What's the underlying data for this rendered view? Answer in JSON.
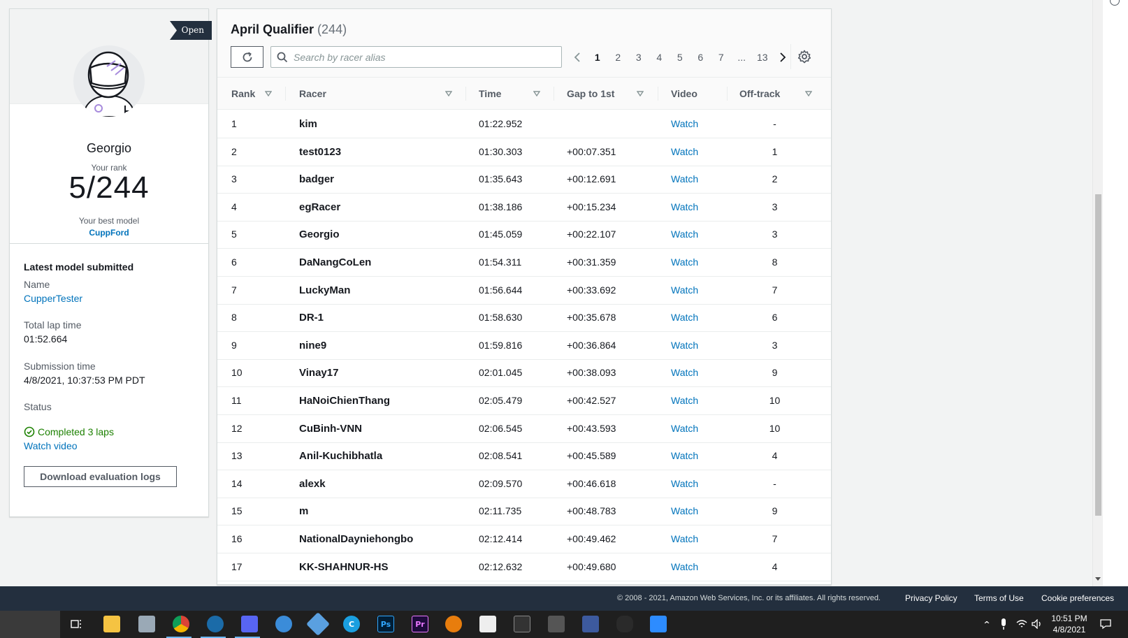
{
  "profile": {
    "badge": "Open",
    "name": "Georgio",
    "rank_label": "Your rank",
    "rank_value": "5/244",
    "best_model_label": "Your best model",
    "best_model": "CuppFord"
  },
  "latest_model": {
    "title": "Latest model submitted",
    "name_label": "Name",
    "name_value": "CupperTester",
    "lap_label": "Total lap time",
    "lap_value": "01:52.664",
    "submission_label": "Submission time",
    "submission_value": "4/8/2021, 10:37:53 PM PDT",
    "status_label": "Status",
    "status_value": "Completed 3 laps",
    "watch_video": "Watch video",
    "download_button": "Download evaluation logs"
  },
  "leaderboard": {
    "title": "April Qualifier",
    "count": "(244)",
    "search_placeholder": "Search by racer alias",
    "pages": [
      "1",
      "2",
      "3",
      "4",
      "5",
      "6",
      "7",
      "...",
      "13"
    ],
    "current_page": "1",
    "columns": {
      "rank": "Rank",
      "racer": "Racer",
      "time": "Time",
      "gap": "Gap to 1st",
      "video": "Video",
      "offtrack": "Off-track"
    },
    "rows": [
      {
        "rank": "1",
        "racer": "kim",
        "time": "01:22.952",
        "gap": "",
        "video": "Watch",
        "offtrack": "-"
      },
      {
        "rank": "2",
        "racer": "test0123",
        "time": "01:30.303",
        "gap": "+00:07.351",
        "video": "Watch",
        "offtrack": "1"
      },
      {
        "rank": "3",
        "racer": "badger",
        "time": "01:35.643",
        "gap": "+00:12.691",
        "video": "Watch",
        "offtrack": "2"
      },
      {
        "rank": "4",
        "racer": "egRacer",
        "time": "01:38.186",
        "gap": "+00:15.234",
        "video": "Watch",
        "offtrack": "3"
      },
      {
        "rank": "5",
        "racer": "Georgio",
        "time": "01:45.059",
        "gap": "+00:22.107",
        "video": "Watch",
        "offtrack": "3"
      },
      {
        "rank": "6",
        "racer": "DaNangCoLen",
        "time": "01:54.311",
        "gap": "+00:31.359",
        "video": "Watch",
        "offtrack": "8"
      },
      {
        "rank": "7",
        "racer": "LuckyMan",
        "time": "01:56.644",
        "gap": "+00:33.692",
        "video": "Watch",
        "offtrack": "7"
      },
      {
        "rank": "8",
        "racer": "DR-1",
        "time": "01:58.630",
        "gap": "+00:35.678",
        "video": "Watch",
        "offtrack": "6"
      },
      {
        "rank": "9",
        "racer": "nine9",
        "time": "01:59.816",
        "gap": "+00:36.864",
        "video": "Watch",
        "offtrack": "3"
      },
      {
        "rank": "10",
        "racer": "Vinay17",
        "time": "02:01.045",
        "gap": "+00:38.093",
        "video": "Watch",
        "offtrack": "9"
      },
      {
        "rank": "11",
        "racer": "HaNoiChienThang",
        "time": "02:05.479",
        "gap": "+00:42.527",
        "video": "Watch",
        "offtrack": "10"
      },
      {
        "rank": "12",
        "racer": "CuBinh-VNN",
        "time": "02:06.545",
        "gap": "+00:43.593",
        "video": "Watch",
        "offtrack": "10"
      },
      {
        "rank": "13",
        "racer": "Anil-Kuchibhatla",
        "time": "02:08.541",
        "gap": "+00:45.589",
        "video": "Watch",
        "offtrack": "4"
      },
      {
        "rank": "14",
        "racer": "alexk",
        "time": "02:09.570",
        "gap": "+00:46.618",
        "video": "Watch",
        "offtrack": "-"
      },
      {
        "rank": "15",
        "racer": "m",
        "time": "02:11.735",
        "gap": "+00:48.783",
        "video": "Watch",
        "offtrack": "9"
      },
      {
        "rank": "16",
        "racer": "NationalDayniehongbo",
        "time": "02:12.414",
        "gap": "+00:49.462",
        "video": "Watch",
        "offtrack": "7"
      },
      {
        "rank": "17",
        "racer": "KK-SHAHNUR-HS",
        "time": "02:12.632",
        "gap": "+00:49.680",
        "video": "Watch",
        "offtrack": "4"
      }
    ]
  },
  "footer": {
    "copyright": "© 2008 - 2021, Amazon Web Services, Inc. or its affiliates. All rights reserved.",
    "privacy": "Privacy Policy",
    "terms": "Terms of Use",
    "cookies": "Cookie preferences"
  },
  "taskbar": {
    "time": "10:51 PM",
    "date": "4/8/2021",
    "apps": [
      "task-view",
      "file-explorer",
      "photos",
      "chrome",
      "steam",
      "discord",
      "dolphin",
      "git",
      "chrome-canary",
      "photoshop",
      "premiere",
      "blender",
      "unity",
      "terminal",
      "cpu-monitor",
      "gamepad",
      "mouse",
      "zoom"
    ]
  },
  "colors": {
    "link": "#0073bb",
    "success": "#1d8102",
    "footer_bg": "#232f3e",
    "ribbon_bg": "#232f3e"
  }
}
